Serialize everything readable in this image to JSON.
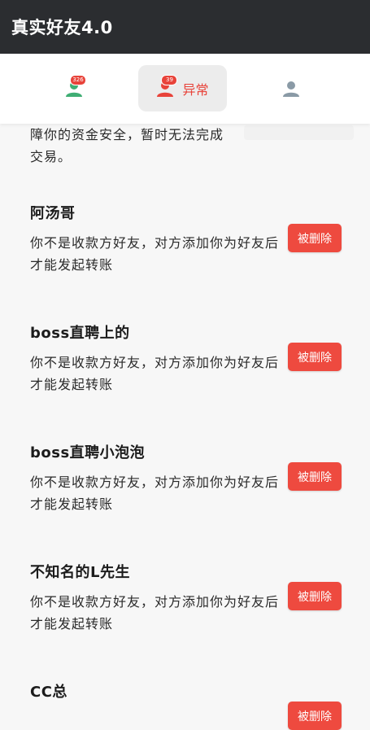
{
  "app": {
    "title": "真实好友4.0"
  },
  "tabs": [
    {
      "icon": "person-icon",
      "badge": "326",
      "label": "",
      "color": "#3fae74",
      "active": false
    },
    {
      "icon": "person-icon",
      "badge": "39",
      "label": "异常",
      "color": "#e8433a",
      "active": true
    },
    {
      "icon": "person-icon",
      "badge": "",
      "label": "",
      "color": "#8a9aa6",
      "active": false
    }
  ],
  "partial_item": {
    "message_line1": "障你的资金安全，暂时无法完成",
    "message_line2": "交易。"
  },
  "items": [
    {
      "name": "阿汤哥",
      "message": "你不是收款方好友，对方添加你为好友后才能发起转账",
      "action": "被删除"
    },
    {
      "name": "boss直聘上的",
      "message": "你不是收款方好友，对方添加你为好友后才能发起转账",
      "action": "被删除"
    },
    {
      "name": "boss直聘小泡泡",
      "message": "你不是收款方好友，对方添加你为好友后才能发起转账",
      "action": "被删除"
    },
    {
      "name": "不知名的L先生",
      "message": "你不是收款方好友，对方添加你为好友后才能发起转账",
      "action": "被删除"
    },
    {
      "name": "CC总",
      "message": "",
      "action": "被删除"
    }
  ],
  "colors": {
    "header_bg": "#2b2d30",
    "danger": "#ee4a3f",
    "normal_tab": "#3fae74",
    "profile_tab": "#8a9aa6"
  }
}
